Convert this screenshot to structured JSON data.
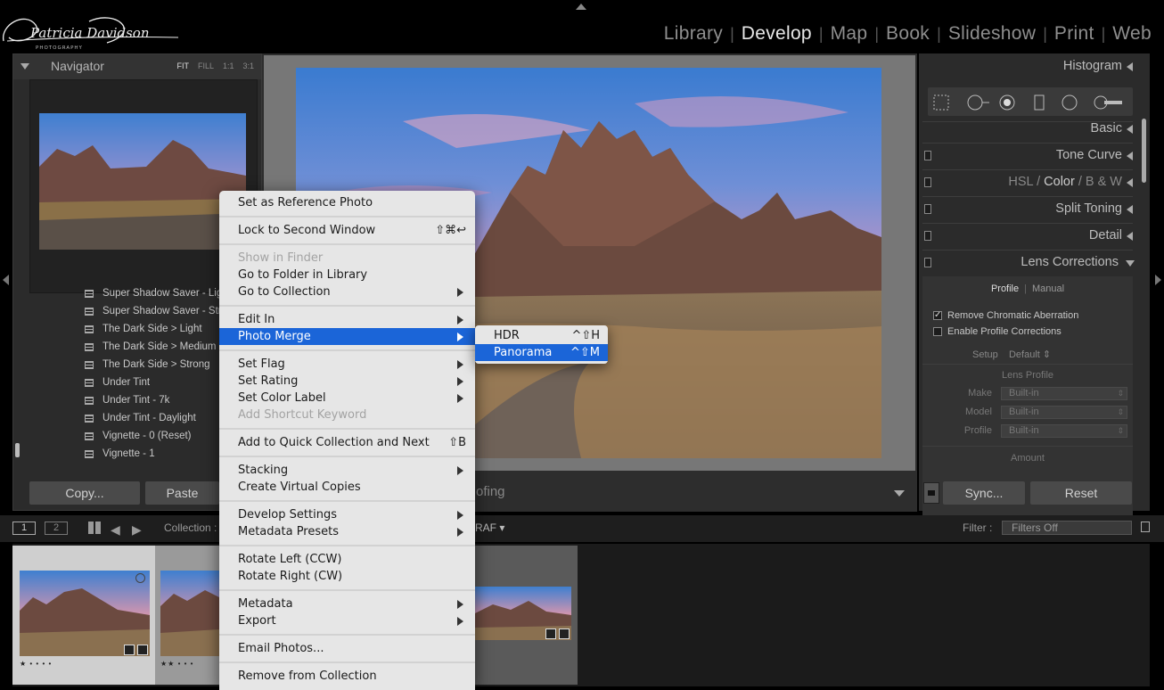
{
  "identity_plate": {
    "name": "Patricia Davidson",
    "tagline": "PHOTOGRAPHY"
  },
  "modules": [
    {
      "label": "Library",
      "active": false
    },
    {
      "label": "Develop",
      "active": true
    },
    {
      "label": "Map",
      "active": false
    },
    {
      "label": "Book",
      "active": false
    },
    {
      "label": "Slideshow",
      "active": false
    },
    {
      "label": "Print",
      "active": false
    },
    {
      "label": "Web",
      "active": false
    }
  ],
  "navigator": {
    "title": "Navigator",
    "modes": [
      "FIT",
      "FILL",
      "1:1",
      "3:1"
    ]
  },
  "presets": [
    "Super Shadow Saver - Light",
    "Super Shadow Saver - Strong",
    "The Dark Side > Light",
    "The Dark Side > Medium",
    "The Dark Side > Strong",
    "Under Tint",
    "Under Tint - 7k",
    "Under Tint - Daylight",
    "Vignette - 0 (Reset)",
    "Vignette - 1"
  ],
  "left_buttons": {
    "copy": "Copy...",
    "paste": "Paste"
  },
  "toolbar": {
    "soft_proofing_fragment": "ofing"
  },
  "right_panel": {
    "histogram": "Histogram",
    "basic": "Basic",
    "tone_curve": "Tone Curve",
    "hsl": "HSL",
    "color": "Color",
    "bw": "B & W",
    "split_toning": "Split Toning",
    "detail": "Detail",
    "lens_corrections": "Lens Corrections",
    "lens_tabs": {
      "profile": "Profile",
      "manual": "Manual"
    },
    "remove_ca": "Remove Chromatic Aberration",
    "remove_ca_checked": true,
    "enable_profile": "Enable Profile Corrections",
    "enable_profile_checked": false,
    "setup_label": "Setup",
    "setup_value": "Default",
    "lens_profile_title": "Lens Profile",
    "make_label": "Make",
    "make_value": "Built-in",
    "model_label": "Model",
    "model_value": "Built-in",
    "profile_label": "Profile",
    "profile_value": "Built-in",
    "amount_title": "Amount",
    "sync": "Sync...",
    "reset": "Reset"
  },
  "filmstrip_bar": {
    "view1": "1",
    "view2": "2",
    "collection_label": "Collection :",
    "source_fragment": "RAF",
    "filter_label": "Filter :",
    "filter_value": "Filters Off"
  },
  "filmstrip": {
    "thumb1_stars": "★ • • • •",
    "thumb2_stars": "★★ • • •"
  },
  "context_menu": {
    "items": [
      {
        "label": "Set as Reference Photo",
        "shortcut": "",
        "submenu": false,
        "disabled": false
      },
      {
        "label": "Lock to Second Window",
        "shortcut": "⇧⌘↩",
        "submenu": false,
        "disabled": false
      },
      {
        "label": "Show in Finder",
        "shortcut": "",
        "submenu": false,
        "disabled": true
      },
      {
        "label": "Go to Folder in Library",
        "shortcut": "",
        "submenu": false,
        "disabled": false
      },
      {
        "label": "Go to Collection",
        "shortcut": "",
        "submenu": true,
        "disabled": false
      },
      {
        "label": "Edit In",
        "shortcut": "",
        "submenu": true,
        "disabled": false
      },
      {
        "label": "Photo Merge",
        "shortcut": "",
        "submenu": true,
        "disabled": false,
        "highlighted": true
      },
      {
        "label": "Set Flag",
        "shortcut": "",
        "submenu": true,
        "disabled": false
      },
      {
        "label": "Set Rating",
        "shortcut": "",
        "submenu": true,
        "disabled": false
      },
      {
        "label": "Set Color Label",
        "shortcut": "",
        "submenu": true,
        "disabled": false
      },
      {
        "label": "Add Shortcut Keyword",
        "shortcut": "",
        "submenu": false,
        "disabled": true
      },
      {
        "label": "Add to Quick Collection and Next",
        "shortcut": "⇧B",
        "submenu": false,
        "disabled": false
      },
      {
        "label": "Stacking",
        "shortcut": "",
        "submenu": true,
        "disabled": false
      },
      {
        "label": "Create Virtual Copies",
        "shortcut": "",
        "submenu": false,
        "disabled": false
      },
      {
        "label": "Develop Settings",
        "shortcut": "",
        "submenu": true,
        "disabled": false
      },
      {
        "label": "Metadata Presets",
        "shortcut": "",
        "submenu": true,
        "disabled": false
      },
      {
        "label": "Rotate Left (CCW)",
        "shortcut": "",
        "submenu": false,
        "disabled": false
      },
      {
        "label": "Rotate Right (CW)",
        "shortcut": "",
        "submenu": false,
        "disabled": false
      },
      {
        "label": "Metadata",
        "shortcut": "",
        "submenu": true,
        "disabled": false
      },
      {
        "label": "Export",
        "shortcut": "",
        "submenu": true,
        "disabled": false
      },
      {
        "label": "Email Photos...",
        "shortcut": "",
        "submenu": false,
        "disabled": false
      },
      {
        "label": "Remove from Collection",
        "shortcut": "",
        "submenu": false,
        "disabled": false
      }
    ]
  },
  "photo_merge_submenu": [
    {
      "label": "HDR",
      "shortcut": "^⇧H",
      "highlighted": false
    },
    {
      "label": "Panorama",
      "shortcut": "^⇧M",
      "highlighted": true
    }
  ],
  "colors": {
    "menu_highlight": "#1b65d8",
    "menu_background": "#e6e6e6",
    "panel_background": "#2b2b2b",
    "active_module": "#e8e8e8"
  }
}
